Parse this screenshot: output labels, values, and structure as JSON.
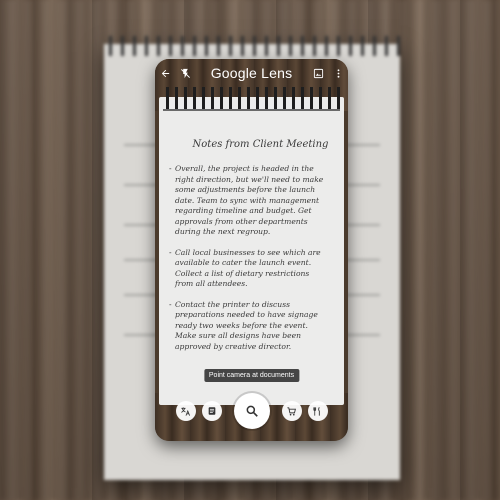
{
  "app": {
    "title": "Google Lens"
  },
  "topbar": {
    "back_icon": "arrow-left-icon",
    "flash_icon": "flash-off-icon",
    "gallery_icon": "image-icon",
    "more_icon": "more-vert-icon"
  },
  "notes": {
    "title": "Notes from Client Meeting",
    "items": [
      {
        "lines": [
          "Overall, the project is headed in the",
          "right direction, but we'll need to make",
          "some adjustments before the launch",
          "date. Team to sync with management",
          "regarding timeline and budget. Get",
          "approvals from other departments",
          "during the next regroup."
        ]
      },
      {
        "lines": [
          "Call local businesses to see which are",
          "available to cater the launch event.",
          "Collect a list of dietary restrictions",
          "from all attendees."
        ]
      },
      {
        "lines": [
          "Contact the printer to discuss",
          "preparations needed to have signage",
          "ready two weeks before the event.",
          "Make sure all designs have been",
          "approved by creative director."
        ]
      }
    ]
  },
  "toast": {
    "text": "Point camera at documents"
  },
  "modes": {
    "translate_icon": "translate-icon",
    "text_icon": "text-icon",
    "search_icon": "search-icon",
    "shopping_icon": "shopping-cart-icon",
    "dining_icon": "restaurant-icon"
  },
  "colors": {
    "toast_bg": "#282828",
    "accent": "#ffffff"
  }
}
